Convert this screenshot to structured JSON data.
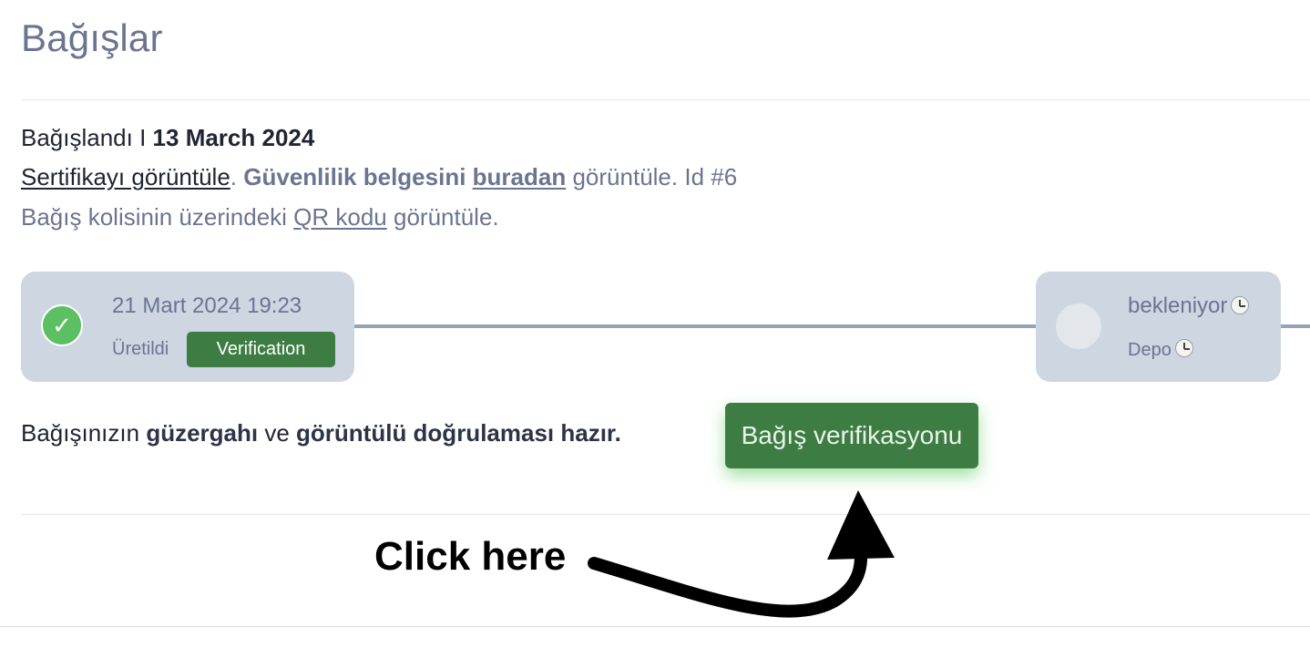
{
  "header": {
    "title": "Bağışlar"
  },
  "donation": {
    "status_label": "Bağışlandı",
    "separator": " I ",
    "date": "13 March 2024",
    "certificate_link": "Sertifikayı görüntüle",
    "period": ". ",
    "safety_doc_text": "Güvenlilik belgesini",
    "safety_doc_link": "buradan",
    "view_text": " görüntüle. Id #6",
    "qr_prefix": "Bağış kolisinin üzerindeki ",
    "qr_link": "QR kodu",
    "qr_suffix": " görüntüle."
  },
  "timeline": {
    "step1": {
      "datetime": "21 Mart 2024 19:23",
      "label": "Üretildi",
      "badge": "Verification",
      "icon": "check-icon"
    },
    "step2": {
      "status": "bekleniyor",
      "label": "Depo",
      "icon": "clock-icon"
    }
  },
  "ready": {
    "text_1": "Bağışınızın ",
    "bold_1": "güzergahı",
    "text_2": " ve ",
    "bold_2": "görüntülü doğrulaması hazır."
  },
  "actions": {
    "verify_button": "Bağış verifikasyonu"
  },
  "annotation": {
    "text": "Click here"
  },
  "colors": {
    "accent_green": "#3d7d43",
    "check_green": "#5cc063",
    "card_bg": "#cdd6e1",
    "muted_text": "#6b7590",
    "dark_text": "#1f2433"
  }
}
